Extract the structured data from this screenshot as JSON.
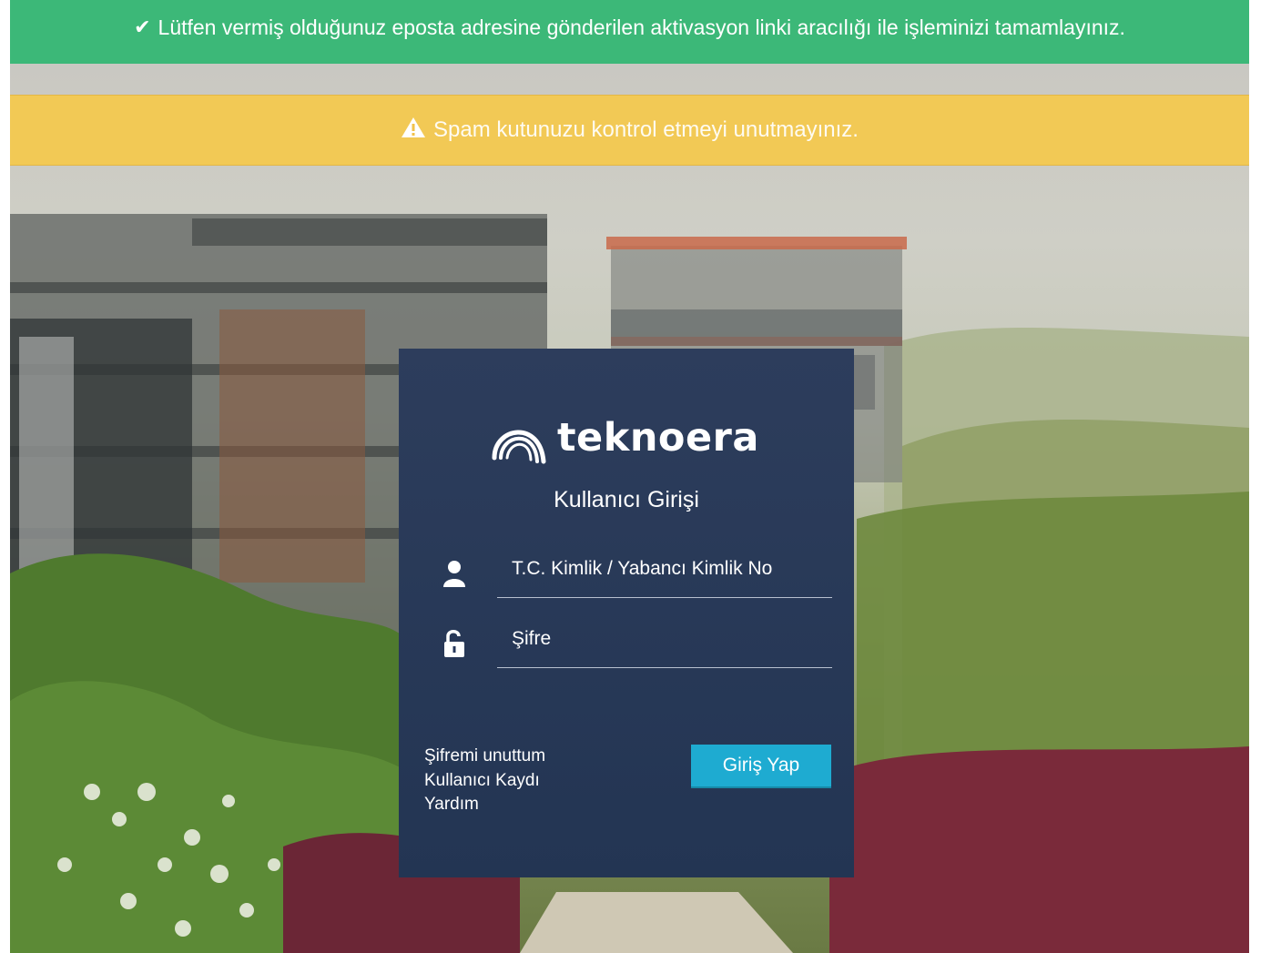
{
  "alerts": {
    "success": {
      "icon": "check-icon",
      "text": "Lütfen vermiş olduğunuz eposta adresine gönderilen aktivasyon linki aracılığı ile işleminizi tamamlayınız.",
      "color": "#3cb878"
    },
    "warning": {
      "icon": "warning-triangle-icon",
      "text": "Spam kutunuzu kontrol etmeyi unutmayınız.",
      "color": "#f7c846"
    }
  },
  "login": {
    "brand": "teknoera",
    "logo_icon": "teknoera-arc-logo-icon",
    "title": "Kullanıcı Girişi",
    "id_field": {
      "icon": "user-icon",
      "placeholder": "T.C. Kimlik / Yabancı Kimlik No",
      "value": ""
    },
    "password_field": {
      "icon": "unlock-icon",
      "placeholder": "Şifre",
      "value": ""
    },
    "links": {
      "forgot_password": "Şifremi unuttum",
      "register": "Kullanıcı Kaydı",
      "help": "Yardım"
    },
    "submit_label": "Giriş Yap",
    "colors": {
      "card": "#2d3d5c",
      "button": "#1eabd1"
    }
  }
}
